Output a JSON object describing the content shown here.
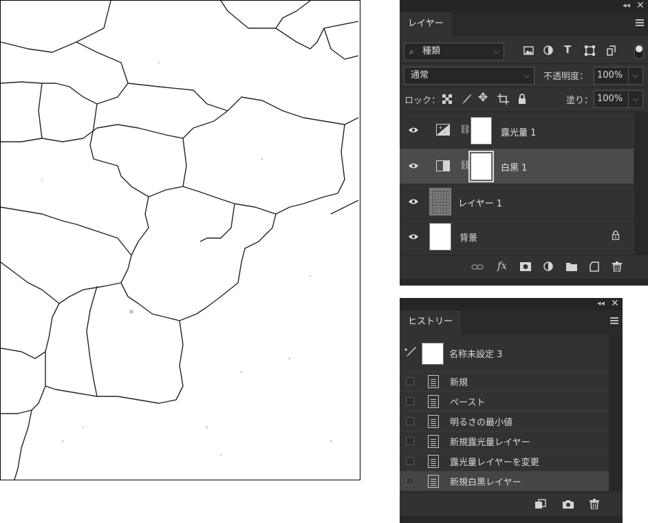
{
  "layers_panel": {
    "tab": "レイヤー",
    "filter_kind": "種類",
    "blend_mode": "通常",
    "opacity_label": "不透明度：",
    "opacity_value": "100%",
    "lock_label": "ロック：",
    "fill_label": "塗り：",
    "fill_value": "100%",
    "layers": [
      {
        "name": "露光量 1",
        "type": "adjustment-exposure"
      },
      {
        "name": "白黒 1",
        "type": "adjustment-bw",
        "selected": true
      },
      {
        "name": "レイヤー 1",
        "type": "pixel"
      },
      {
        "name": "背景",
        "type": "background",
        "locked": true
      }
    ],
    "footer_fx": "fx"
  },
  "history_panel": {
    "tab": "ヒストリー",
    "snapshot_name": "名称未設定 3",
    "items": [
      "新規",
      "ペースト",
      "明るさの最小値",
      "新規露光量レイヤー",
      "露光量レイヤーを変更",
      "新規白黒レイヤー"
    ]
  },
  "colors": {
    "panel_bg": "#323232",
    "selected_row": "#4b4b4b",
    "canvas_bg": "#ffffff"
  }
}
